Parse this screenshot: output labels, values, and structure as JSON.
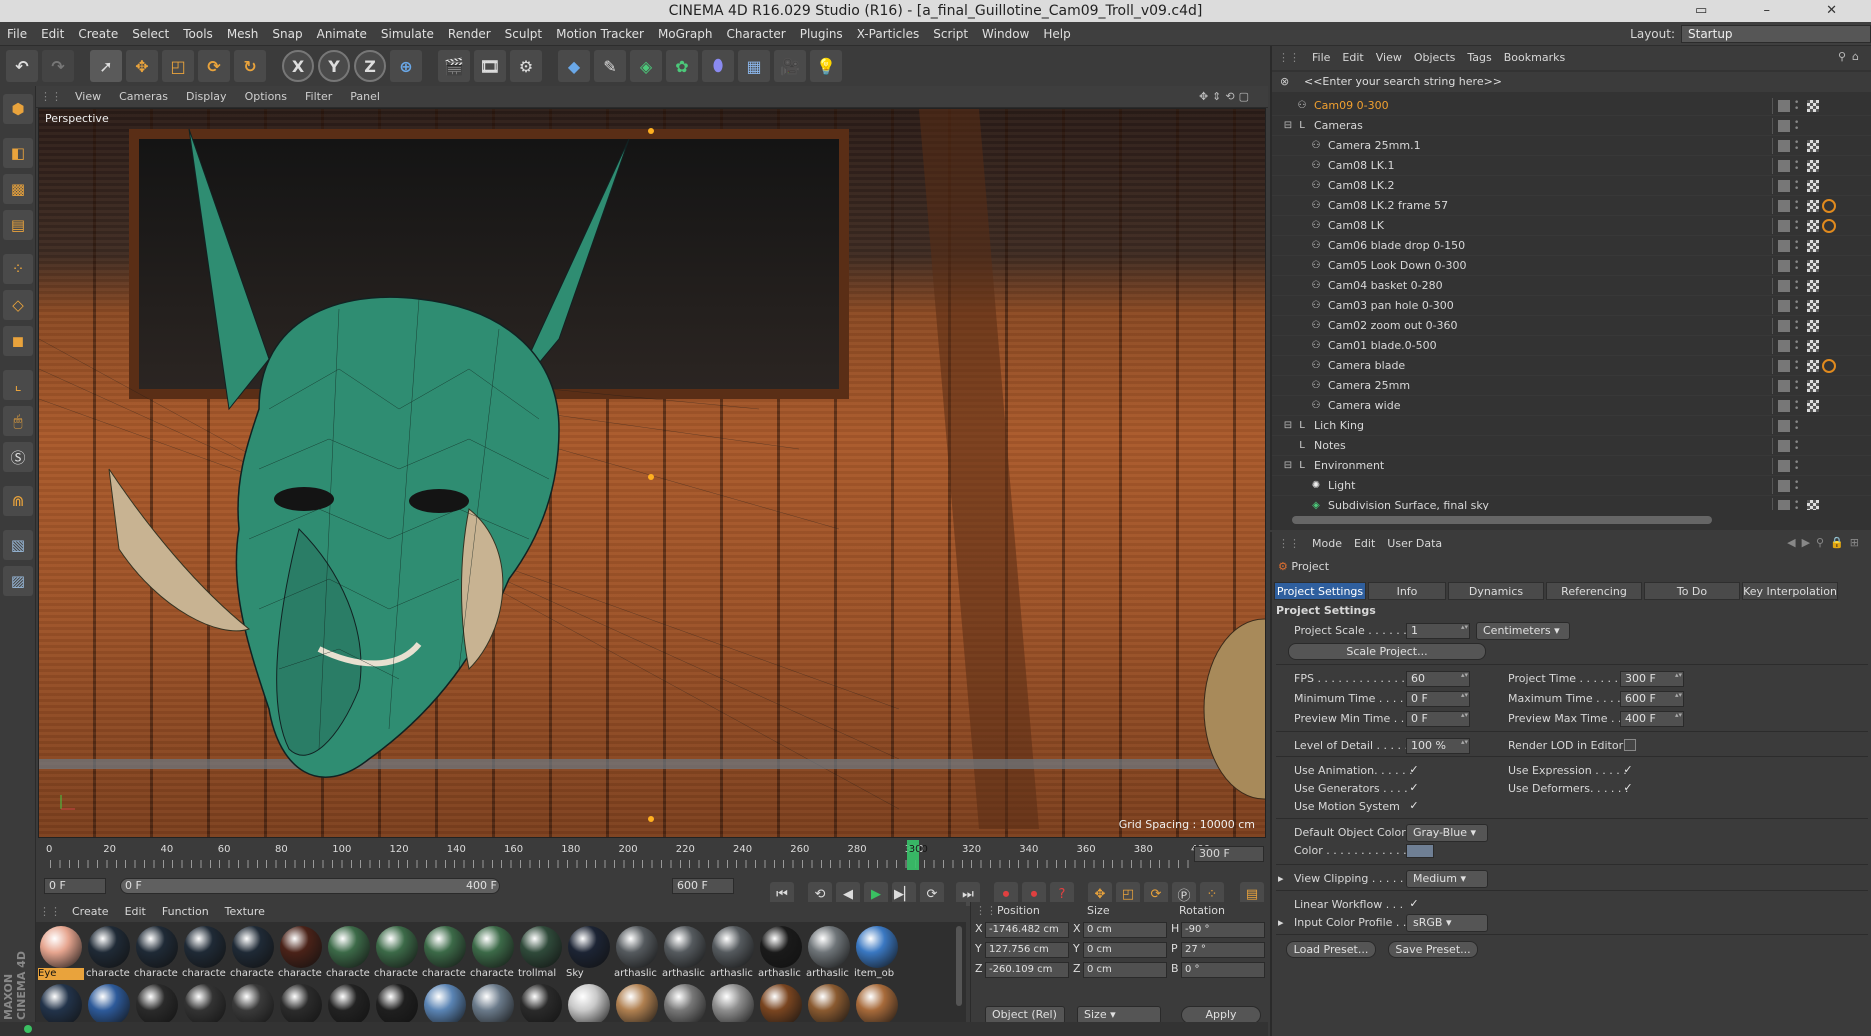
{
  "window": {
    "title": "CINEMA 4D R16.029 Studio (R16) - [a_final_Guillotine_Cam09_Troll_v09.c4d]"
  },
  "menubar": {
    "items": [
      "File",
      "Edit",
      "Create",
      "Select",
      "Tools",
      "Mesh",
      "Snap",
      "Animate",
      "Simulate",
      "Render",
      "Sculpt",
      "Motion Tracker",
      "MoGraph",
      "Character",
      "Plugins",
      "X-Particles",
      "Script",
      "Window",
      "Help"
    ],
    "layout_label": "Layout:",
    "layout_value": "Startup"
  },
  "toolbar": {
    "x_label": "X",
    "y_label": "Y",
    "z_label": "Z"
  },
  "viewport": {
    "menu": [
      "View",
      "Cameras",
      "Display",
      "Options",
      "Filter",
      "Panel"
    ],
    "label": "Perspective",
    "grid_spacing": "Grid Spacing : 10000 cm"
  },
  "timeline": {
    "ticks": [
      "0",
      "20",
      "40",
      "60",
      "80",
      "100",
      "120",
      "140",
      "160",
      "180",
      "200",
      "220",
      "240",
      "260",
      "280",
      "300",
      "320",
      "340",
      "360",
      "380",
      "400"
    ],
    "current": "300",
    "end_frame": "300 F",
    "playhead_fraction": 0.75
  },
  "transport": {
    "start": "0 F",
    "range_start": "0 F",
    "range_end": "400 F",
    "end": "600 F"
  },
  "materials": {
    "menu": [
      "Create",
      "Edit",
      "Function",
      "Texture"
    ],
    "row1": [
      {
        "label": "Eye",
        "color": "#e6a58f",
        "selected": true
      },
      {
        "label": "characte",
        "color": "#1f2a36"
      },
      {
        "label": "characte",
        "color": "#1f2a36"
      },
      {
        "label": "characte",
        "color": "#1f2a36"
      },
      {
        "label": "characte",
        "color": "#1f2a36"
      },
      {
        "label": "characte",
        "color": "#4a2218"
      },
      {
        "label": "characte",
        "color": "#3c6a48"
      },
      {
        "label": "characte",
        "color": "#3c6a48"
      },
      {
        "label": "characte",
        "color": "#3c6a48"
      },
      {
        "label": "characte",
        "color": "#3c6a48"
      },
      {
        "label": "trollmal",
        "color": "#2f4a3a"
      },
      {
        "label": "Sky",
        "color": "#1c2434"
      },
      {
        "label": "arthaslic",
        "color": "#555a5e"
      },
      {
        "label": "arthaslic",
        "color": "#555a5e"
      },
      {
        "label": "arthaslic",
        "color": "#555a5e"
      },
      {
        "label": "arthaslic",
        "color": "#1a1a1a"
      },
      {
        "label": "arthaslic",
        "color": "#6e7478"
      },
      {
        "label": "item_ob",
        "color": "#3a78c2"
      }
    ],
    "row2_colors": [
      "#22334a",
      "#2d5a9a",
      "#2a2a2a",
      "#333",
      "#3a3a3a",
      "#2b2b2b",
      "#222",
      "#1f1f1f",
      "#5a84b4",
      "#6a7a8a",
      "#2a2a2a",
      "#c9c9c9",
      "#b08050",
      "#777",
      "#8e8e8e",
      "#7a4520",
      "#8a5a30",
      "#a76a3a"
    ]
  },
  "coordinates": {
    "headers": [
      "Position",
      "Size",
      "Rotation"
    ],
    "rows": [
      {
        "axis": "X",
        "pos": "-1746.482 cm",
        "size_axis": "X",
        "size": "0 cm",
        "rot_axis": "H",
        "rot": "-90 °"
      },
      {
        "axis": "Y",
        "pos": "127.756 cm",
        "size_axis": "Y",
        "size": "0 cm",
        "rot_axis": "P",
        "rot": "27 °"
      },
      {
        "axis": "Z",
        "pos": "-260.109 cm",
        "size_axis": "Z",
        "size": "0 cm",
        "rot_axis": "B",
        "rot": "0 °"
      }
    ],
    "mode": "Object (Rel)",
    "size_mode": "Size",
    "apply": "Apply"
  },
  "object_manager": {
    "menu": [
      "File",
      "Edit",
      "View",
      "Objects",
      "Tags",
      "Bookmarks"
    ],
    "search_placeholder": "<<Enter your search string here>>",
    "rows": [
      {
        "name": "Cam09 0-300",
        "indent": 0,
        "kind": "camera",
        "highlight": true,
        "badge": false
      },
      {
        "name": "Cameras",
        "indent": 0,
        "kind": "null",
        "expand": true,
        "badge": false
      },
      {
        "name": "Camera 25mm.1",
        "indent": 1,
        "kind": "camera",
        "badge": false
      },
      {
        "name": "Cam08 LK.1",
        "indent": 1,
        "kind": "camera",
        "badge": false
      },
      {
        "name": "Cam08 LK.2",
        "indent": 1,
        "kind": "camera",
        "badge": false
      },
      {
        "name": "Cam08 LK.2 frame 57",
        "indent": 1,
        "kind": "camera",
        "badge": true
      },
      {
        "name": "Cam08 LK",
        "indent": 1,
        "kind": "camera",
        "badge": true
      },
      {
        "name": "Cam06 blade drop 0-150",
        "indent": 1,
        "kind": "camera",
        "badge": false
      },
      {
        "name": "Cam05 Look Down 0-300",
        "indent": 1,
        "kind": "camera",
        "badge": false
      },
      {
        "name": "Cam04 basket 0-280",
        "indent": 1,
        "kind": "camera",
        "badge": false
      },
      {
        "name": "Cam03 pan hole 0-300",
        "indent": 1,
        "kind": "camera",
        "badge": false
      },
      {
        "name": "Cam02 zoom out 0-360",
        "indent": 1,
        "kind": "camera",
        "badge": false
      },
      {
        "name": "Cam01 blade.0-500",
        "indent": 1,
        "kind": "camera",
        "badge": false
      },
      {
        "name": "Camera blade",
        "indent": 1,
        "kind": "camera",
        "badge": true
      },
      {
        "name": "Camera 25mm",
        "indent": 1,
        "kind": "camera",
        "badge": false
      },
      {
        "name": "Camera wide",
        "indent": 1,
        "kind": "camera",
        "badge": false
      },
      {
        "name": "Lich King",
        "indent": 0,
        "kind": "null",
        "expand": true,
        "badge": false
      },
      {
        "name": "Notes",
        "indent": 0,
        "kind": "null",
        "badge": false
      },
      {
        "name": "Environment",
        "indent": 0,
        "kind": "null",
        "expand": true,
        "badge": false
      },
      {
        "name": "Light",
        "indent": 1,
        "kind": "light",
        "badge": false
      },
      {
        "name": "Subdivision Surface, final sky",
        "indent": 1,
        "kind": "subdiv",
        "badge": false
      }
    ]
  },
  "attributes": {
    "menu": [
      "Mode",
      "Edit",
      "User Data"
    ],
    "header": "Project",
    "tabs": [
      "Project Settings",
      "Info",
      "Dynamics",
      "Referencing",
      "To Do",
      "Key Interpolation"
    ],
    "section": "Project Settings",
    "project_scale_label": "Project Scale . . . . . .",
    "project_scale_value": "1",
    "project_scale_unit": "Centimeters",
    "scale_project_button": "Scale Project...",
    "fps_label": "FPS . . . . . . . . . . . . . .",
    "fps_value": "60",
    "min_time_label": "Minimum Time . . . .",
    "min_time_value": "0 F",
    "preview_min_label": "Preview Min Time . .",
    "preview_min_value": "0 F",
    "project_time_label": "Project Time . . . . . . . .",
    "project_time_value": "300 F",
    "max_time_label": "Maximum Time . . . .",
    "max_time_value": "600 F",
    "preview_max_label": "Preview Max Time . .",
    "preview_max_value": "400 F",
    "lod_label": "Level of Detail . . . . .",
    "lod_value": "100 %",
    "render_lod_label": "Render LOD in Editor",
    "use_animation_label": "Use Animation. . . . . .",
    "use_generators_label": "Use Generators . . . .",
    "use_motion_label": "Use Motion System",
    "use_expression_label": "Use Expression . . . . .",
    "use_deformers_label": "Use Deformers. . . . . .",
    "default_color_label": "Default Object Color",
    "default_color_value": "Gray-Blue",
    "color_label": "Color . . . . . . . . . . . .",
    "color_swatch": "#6f7f94",
    "view_clipping_label": "View Clipping . . . . .",
    "view_clipping_value": "Medium",
    "linear_workflow_label": "Linear Workflow . . .",
    "input_profile_label": "Input Color Profile . .",
    "input_profile_value": "sRGB",
    "load_preset": "Load Preset...",
    "save_preset": "Save Preset..."
  },
  "brand": {
    "logo_text": "MAXON CINEMA 4D"
  }
}
